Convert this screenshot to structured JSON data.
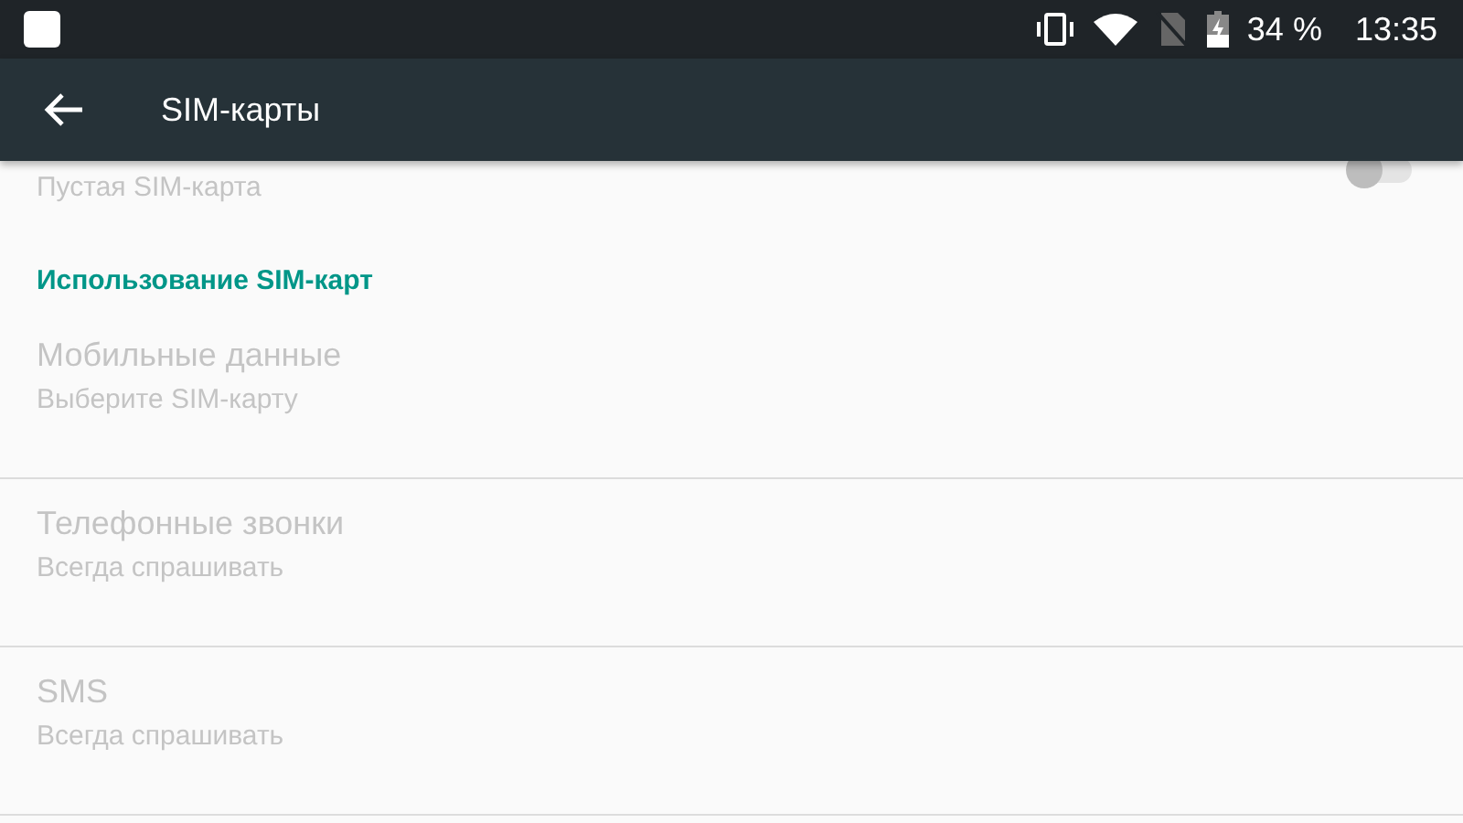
{
  "status_bar": {
    "battery": "34 %",
    "time": "13:35"
  },
  "toolbar": {
    "title": "SIM-карты"
  },
  "sim_row": {
    "subtitle": "Пустая SIM-карта",
    "on": false,
    "disabled": true
  },
  "section": {
    "title": "Использование SIM-карт"
  },
  "items": [
    {
      "title": "Мобильные данные",
      "subtitle": "Выберите SIM-карту",
      "disabled": true
    },
    {
      "title": "Телефонные звонки",
      "subtitle": "Всегда спрашивать",
      "disabled": true
    },
    {
      "title": "SMS",
      "subtitle": "Всегда спрашивать",
      "disabled": true
    }
  ]
}
